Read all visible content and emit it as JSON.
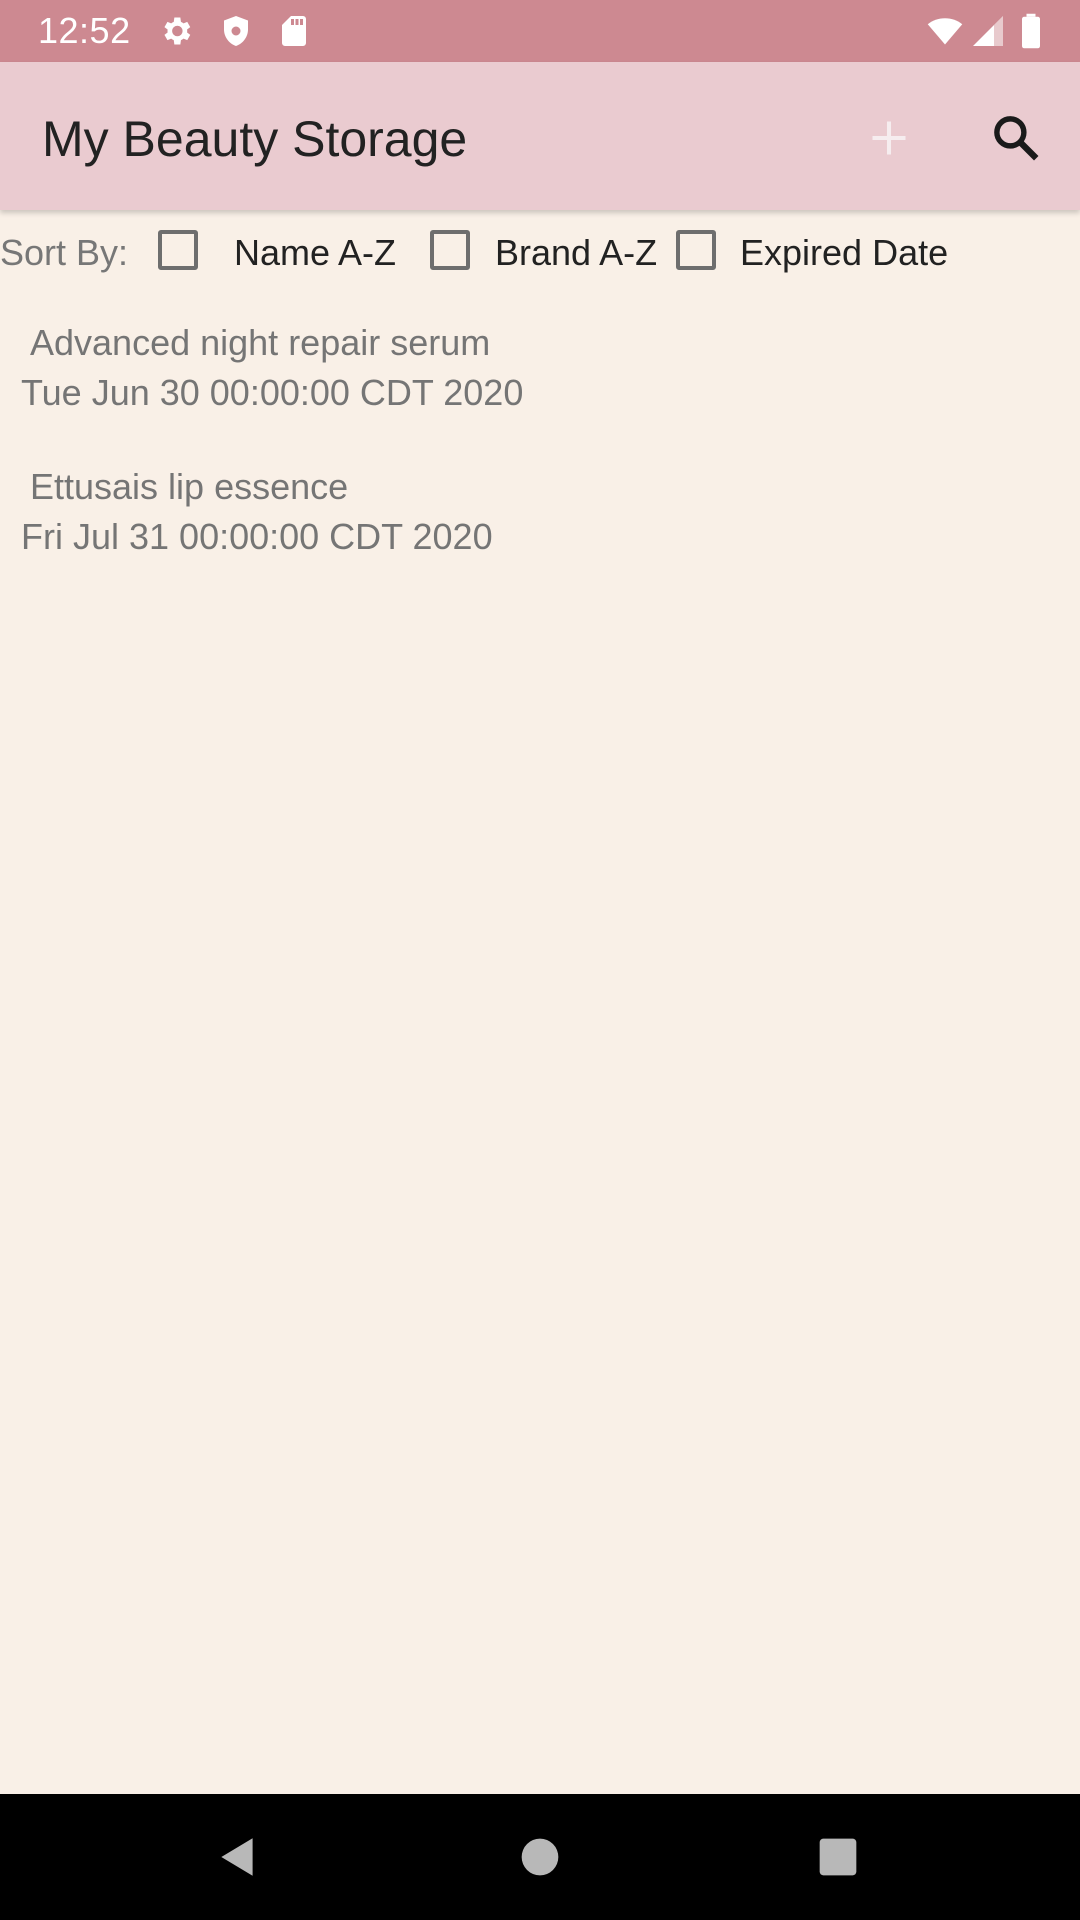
{
  "status_bar": {
    "time": "12:52",
    "left_icons": [
      "gear-icon",
      "shield-icon",
      "sd-card-icon"
    ],
    "right_icons": [
      "wifi-icon",
      "signal-icon",
      "battery-icon"
    ],
    "background": "#CD8991"
  },
  "app_bar": {
    "title": "My Beauty Storage",
    "actions": [
      "plus-icon",
      "search-icon"
    ],
    "background": "#EACBD0"
  },
  "sort": {
    "label": "Sort By:",
    "options": [
      {
        "label": "Name A-Z",
        "checked": false
      },
      {
        "label": "Brand A-Z",
        "checked": false
      },
      {
        "label": "Expired Date",
        "checked": false
      }
    ]
  },
  "items": [
    {
      "name": "Advanced night repair serum",
      "date": "Tue Jun 30 00:00:00 CDT 2020"
    },
    {
      "name": "Ettusais lip essence",
      "date": "Fri Jul 31 00:00:00 CDT 2020"
    }
  ],
  "nav_bar": {
    "buttons": [
      "back-icon",
      "home-icon",
      "recents-icon"
    ]
  },
  "colors": {
    "page_background": "#F9F0E7",
    "nav_background": "#000000"
  }
}
